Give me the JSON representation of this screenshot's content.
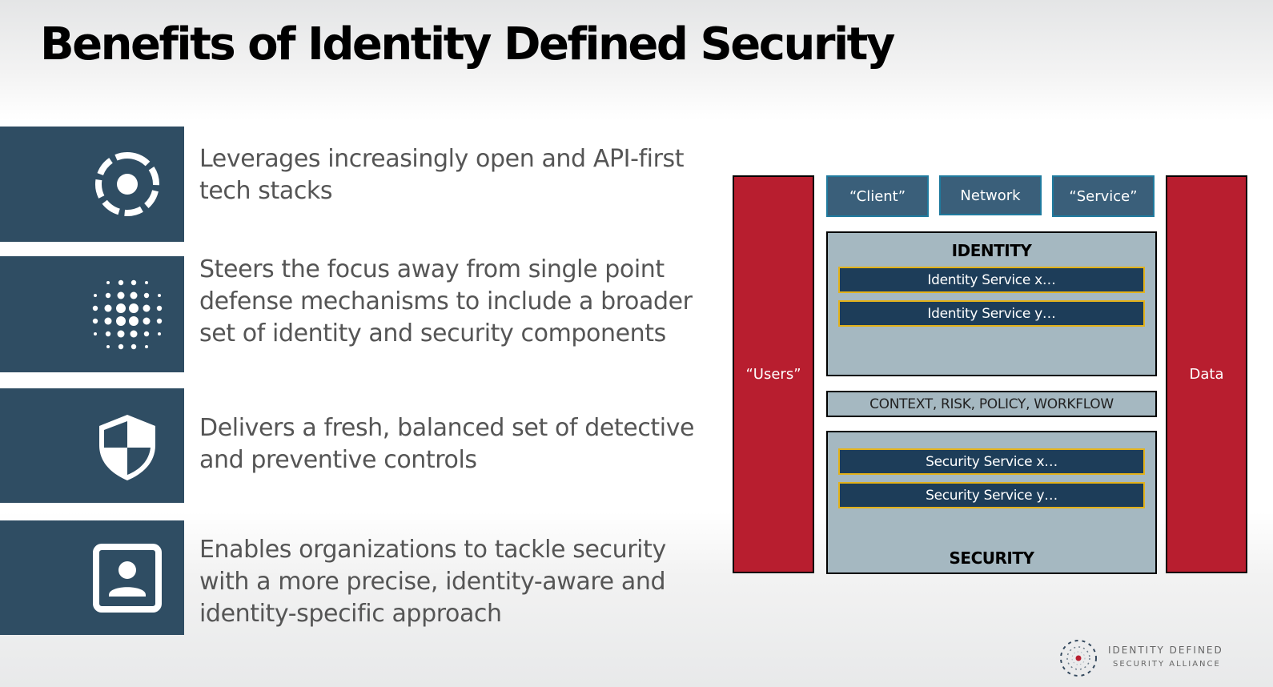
{
  "slide": {
    "title": "Benefits of Identity Defined Security",
    "colors": {
      "tile": "#2f4d63",
      "text": "#555555",
      "red_column": "#b81e2f",
      "top_box": "#3a5f7a",
      "top_box_border": "#1f7a9e",
      "panel": "#a5b8c1",
      "service_bar": "#1d3d59",
      "service_border": "#e3b21a"
    }
  },
  "benefits": [
    {
      "icon": "dashed-circle-target-icon",
      "text": "Leverages increasingly open and API-first\ntech stacks"
    },
    {
      "icon": "dot-grid-sphere-icon",
      "text": "Steers the focus away from single point\ndefense mechanisms to include a broader\nset of identity and security components"
    },
    {
      "icon": "shield-icon",
      "text": "Delivers a fresh, balanced set of detective\nand preventive controls"
    },
    {
      "icon": "user-portrait-icon",
      "text": "Enables organizations to tackle security\nwith a more precise, identity-aware and\nidentity-specific approach"
    }
  ],
  "diagram": {
    "left_column": "“Users”",
    "right_column": "Data",
    "top_boxes": [
      "“Client”",
      "Network",
      "“Service”"
    ],
    "identity": {
      "heading": "IDENTITY",
      "services": [
        "Identity Service x…",
        "Identity Service y…"
      ]
    },
    "context_bar": "CONTEXT, RISK, POLICY, WORKFLOW",
    "security": {
      "heading": "SECURITY",
      "services": [
        "Security Service x…",
        "Security Service y…"
      ]
    }
  },
  "footer": {
    "logo_icon": "alliance-logo-icon",
    "line1": "IDENTITY DEFINED",
    "line2": "SECURITY ALLIANCE"
  }
}
